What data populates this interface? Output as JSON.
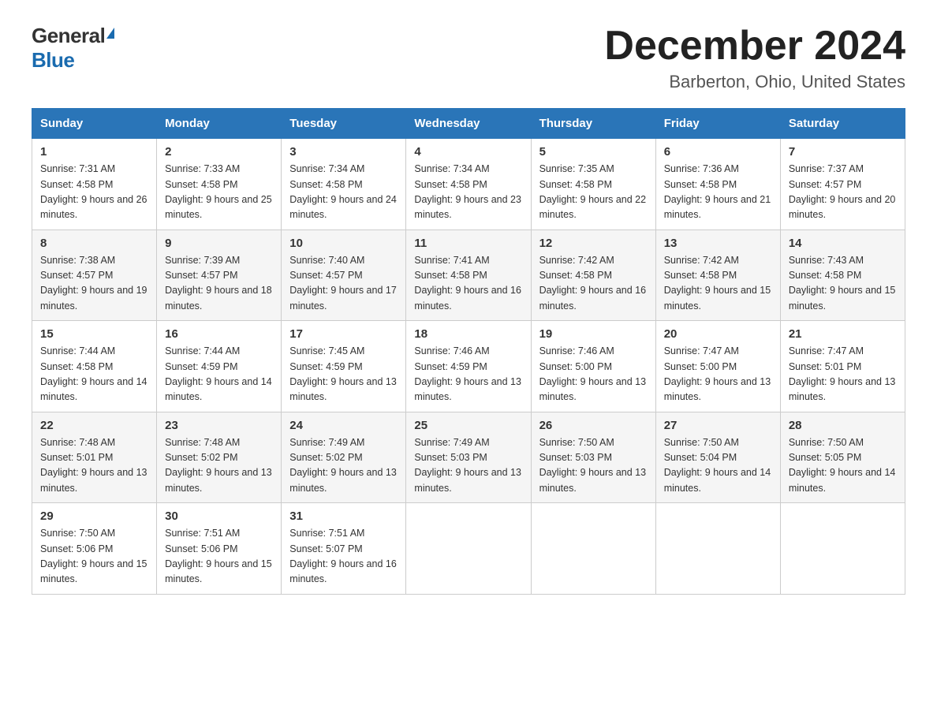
{
  "logo": {
    "general": "General",
    "blue": "Blue"
  },
  "title": {
    "month_year": "December 2024",
    "location": "Barberton, Ohio, United States"
  },
  "weekdays": [
    "Sunday",
    "Monday",
    "Tuesday",
    "Wednesday",
    "Thursday",
    "Friday",
    "Saturday"
  ],
  "weeks": [
    [
      {
        "day": "1",
        "sunrise": "7:31 AM",
        "sunset": "4:58 PM",
        "daylight": "9 hours and 26 minutes."
      },
      {
        "day": "2",
        "sunrise": "7:33 AM",
        "sunset": "4:58 PM",
        "daylight": "9 hours and 25 minutes."
      },
      {
        "day": "3",
        "sunrise": "7:34 AM",
        "sunset": "4:58 PM",
        "daylight": "9 hours and 24 minutes."
      },
      {
        "day": "4",
        "sunrise": "7:34 AM",
        "sunset": "4:58 PM",
        "daylight": "9 hours and 23 minutes."
      },
      {
        "day": "5",
        "sunrise": "7:35 AM",
        "sunset": "4:58 PM",
        "daylight": "9 hours and 22 minutes."
      },
      {
        "day": "6",
        "sunrise": "7:36 AM",
        "sunset": "4:58 PM",
        "daylight": "9 hours and 21 minutes."
      },
      {
        "day": "7",
        "sunrise": "7:37 AM",
        "sunset": "4:57 PM",
        "daylight": "9 hours and 20 minutes."
      }
    ],
    [
      {
        "day": "8",
        "sunrise": "7:38 AM",
        "sunset": "4:57 PM",
        "daylight": "9 hours and 19 minutes."
      },
      {
        "day": "9",
        "sunrise": "7:39 AM",
        "sunset": "4:57 PM",
        "daylight": "9 hours and 18 minutes."
      },
      {
        "day": "10",
        "sunrise": "7:40 AM",
        "sunset": "4:57 PM",
        "daylight": "9 hours and 17 minutes."
      },
      {
        "day": "11",
        "sunrise": "7:41 AM",
        "sunset": "4:58 PM",
        "daylight": "9 hours and 16 minutes."
      },
      {
        "day": "12",
        "sunrise": "7:42 AM",
        "sunset": "4:58 PM",
        "daylight": "9 hours and 16 minutes."
      },
      {
        "day": "13",
        "sunrise": "7:42 AM",
        "sunset": "4:58 PM",
        "daylight": "9 hours and 15 minutes."
      },
      {
        "day": "14",
        "sunrise": "7:43 AM",
        "sunset": "4:58 PM",
        "daylight": "9 hours and 15 minutes."
      }
    ],
    [
      {
        "day": "15",
        "sunrise": "7:44 AM",
        "sunset": "4:58 PM",
        "daylight": "9 hours and 14 minutes."
      },
      {
        "day": "16",
        "sunrise": "7:44 AM",
        "sunset": "4:59 PM",
        "daylight": "9 hours and 14 minutes."
      },
      {
        "day": "17",
        "sunrise": "7:45 AM",
        "sunset": "4:59 PM",
        "daylight": "9 hours and 13 minutes."
      },
      {
        "day": "18",
        "sunrise": "7:46 AM",
        "sunset": "4:59 PM",
        "daylight": "9 hours and 13 minutes."
      },
      {
        "day": "19",
        "sunrise": "7:46 AM",
        "sunset": "5:00 PM",
        "daylight": "9 hours and 13 minutes."
      },
      {
        "day": "20",
        "sunrise": "7:47 AM",
        "sunset": "5:00 PM",
        "daylight": "9 hours and 13 minutes."
      },
      {
        "day": "21",
        "sunrise": "7:47 AM",
        "sunset": "5:01 PM",
        "daylight": "9 hours and 13 minutes."
      }
    ],
    [
      {
        "day": "22",
        "sunrise": "7:48 AM",
        "sunset": "5:01 PM",
        "daylight": "9 hours and 13 minutes."
      },
      {
        "day": "23",
        "sunrise": "7:48 AM",
        "sunset": "5:02 PM",
        "daylight": "9 hours and 13 minutes."
      },
      {
        "day": "24",
        "sunrise": "7:49 AM",
        "sunset": "5:02 PM",
        "daylight": "9 hours and 13 minutes."
      },
      {
        "day": "25",
        "sunrise": "7:49 AM",
        "sunset": "5:03 PM",
        "daylight": "9 hours and 13 minutes."
      },
      {
        "day": "26",
        "sunrise": "7:50 AM",
        "sunset": "5:03 PM",
        "daylight": "9 hours and 13 minutes."
      },
      {
        "day": "27",
        "sunrise": "7:50 AM",
        "sunset": "5:04 PM",
        "daylight": "9 hours and 14 minutes."
      },
      {
        "day": "28",
        "sunrise": "7:50 AM",
        "sunset": "5:05 PM",
        "daylight": "9 hours and 14 minutes."
      }
    ],
    [
      {
        "day": "29",
        "sunrise": "7:50 AM",
        "sunset": "5:06 PM",
        "daylight": "9 hours and 15 minutes."
      },
      {
        "day": "30",
        "sunrise": "7:51 AM",
        "sunset": "5:06 PM",
        "daylight": "9 hours and 15 minutes."
      },
      {
        "day": "31",
        "sunrise": "7:51 AM",
        "sunset": "5:07 PM",
        "daylight": "9 hours and 16 minutes."
      },
      null,
      null,
      null,
      null
    ]
  ],
  "labels": {
    "sunrise": "Sunrise: ",
    "sunset": "Sunset: ",
    "daylight": "Daylight: "
  }
}
